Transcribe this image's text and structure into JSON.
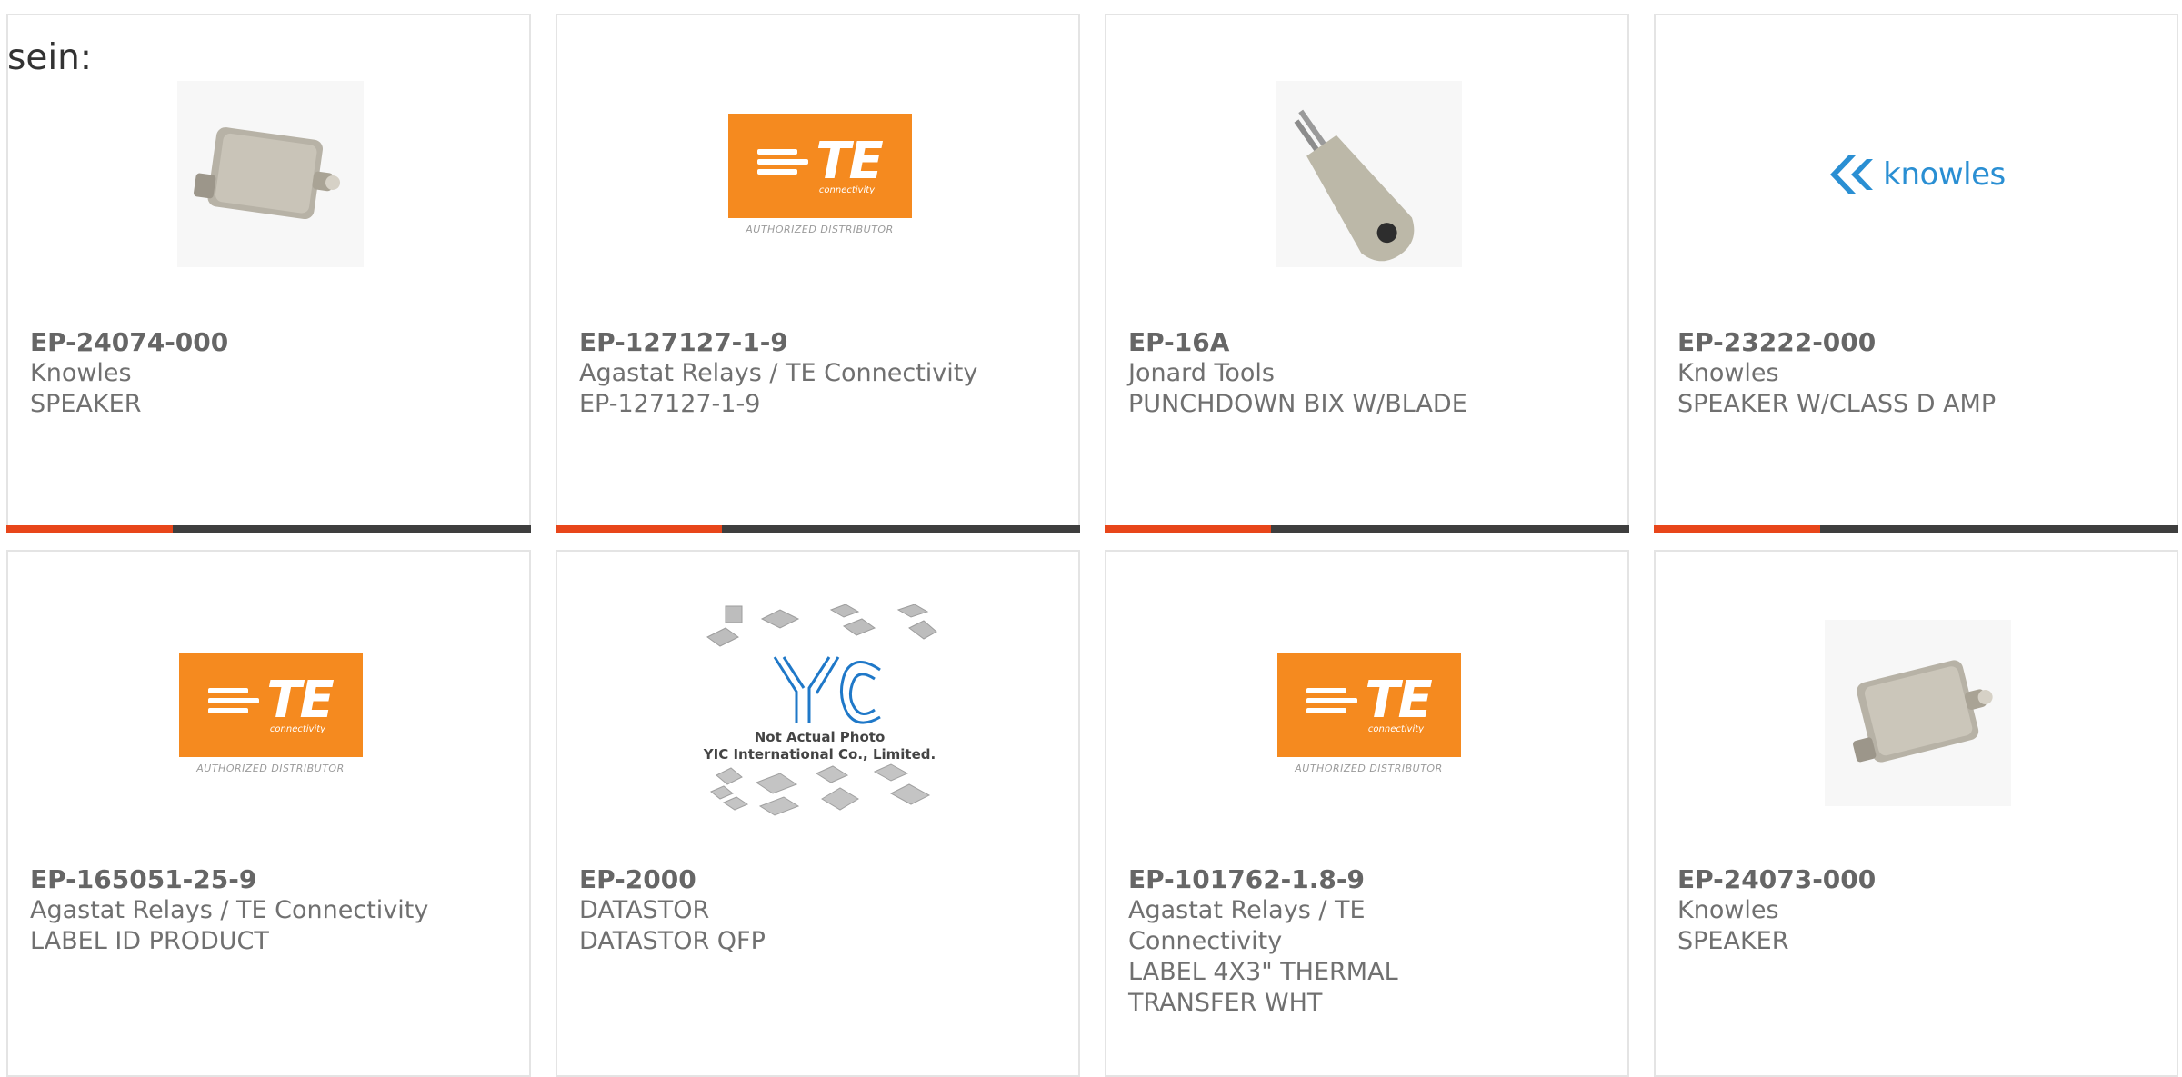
{
  "intro_text": "sein:",
  "brand_colors": {
    "accent": "#e8461a",
    "bar": "#3e3e3e",
    "te_orange": "#f58a1f",
    "knowles_blue": "#2a8fd3"
  },
  "products": [
    {
      "part_number": "EP-24074-000",
      "manufacturer": "Knowles",
      "description": "SPEAKER",
      "image": "speaker-photo"
    },
    {
      "part_number": "EP-127127-1-9",
      "manufacturer": "Agastat Relays / TE Connectivity",
      "description": "EP-127127-1-9",
      "image": "te-logo"
    },
    {
      "part_number": "EP-16A",
      "manufacturer": "Jonard Tools",
      "description": "PUNCHDOWN BIX W/BLADE",
      "image": "punchdown-tool-photo"
    },
    {
      "part_number": "EP-23222-000",
      "manufacturer": "Knowles",
      "description": "SPEAKER W/CLASS D AMP",
      "image": "knowles-logo"
    },
    {
      "part_number": "EP-165051-25-9",
      "manufacturer": "Agastat Relays / TE Connectivity",
      "description": "LABEL ID PRODUCT",
      "image": "te-logo"
    },
    {
      "part_number": "EP-2000",
      "manufacturer": "DATASTOR",
      "description": "DATASTOR QFP",
      "image": "yic-placeholder"
    },
    {
      "part_number": "EP-101762-1.8-9",
      "manufacturer": "Agastat Relays / TE Connectivity",
      "description": "LABEL 4X3\" THERMAL TRANSFER WHT",
      "image": "te-logo"
    },
    {
      "part_number": "EP-24073-000",
      "manufacturer": "Knowles",
      "description": "SPEAKER",
      "image": "speaker-photo"
    }
  ],
  "logos": {
    "te_word": "TE",
    "te_sub": "connectivity",
    "te_authorized": "AUTHORIZED DISTRIBUTOR",
    "knowles_word": "knowles",
    "yic_line1": "Not Actual Photo",
    "yic_line2": "YIC International Co., Limited."
  }
}
